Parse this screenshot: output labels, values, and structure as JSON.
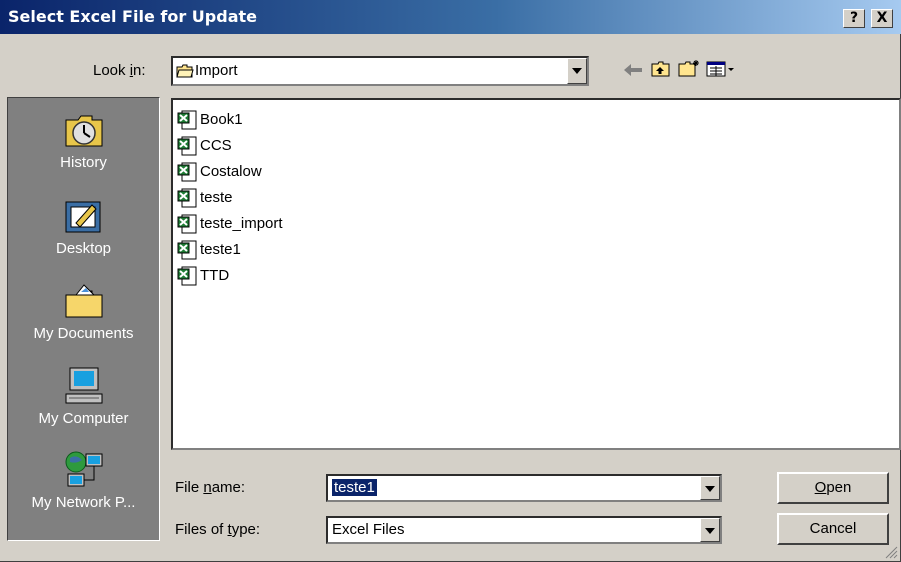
{
  "window": {
    "title": "Select Excel File for Update",
    "help_label": "?",
    "close_label": "X"
  },
  "toolbar": {
    "look_in_prefix": "Look ",
    "look_in_accel": "i",
    "look_in_suffix": "n:",
    "current_folder": "Import",
    "back_icon": "back-arrow-icon",
    "up_icon": "up-one-level-icon",
    "new_folder_icon": "new-folder-icon",
    "views_icon": "views-menu-icon"
  },
  "places": [
    {
      "label": "History",
      "icon": "history-icon"
    },
    {
      "label": "Desktop",
      "icon": "desktop-icon"
    },
    {
      "label": "My Documents",
      "icon": "my-documents-icon"
    },
    {
      "label": "My Computer",
      "icon": "my-computer-icon"
    },
    {
      "label": "My Network P...",
      "icon": "my-network-places-icon"
    }
  ],
  "files": [
    "Book1",
    "CCS",
    "Costalow",
    "teste",
    "teste_import",
    "teste1",
    "TTD"
  ],
  "filename": {
    "label_prefix": "File ",
    "label_accel": "n",
    "label_suffix": "ame:",
    "value": "teste1"
  },
  "filetype": {
    "label_prefix": "Files of ",
    "label_accel": "t",
    "label_suffix": "ype:",
    "value": "Excel Files"
  },
  "buttons": {
    "open_accel": "O",
    "open_rest": "pen",
    "cancel": "Cancel"
  }
}
